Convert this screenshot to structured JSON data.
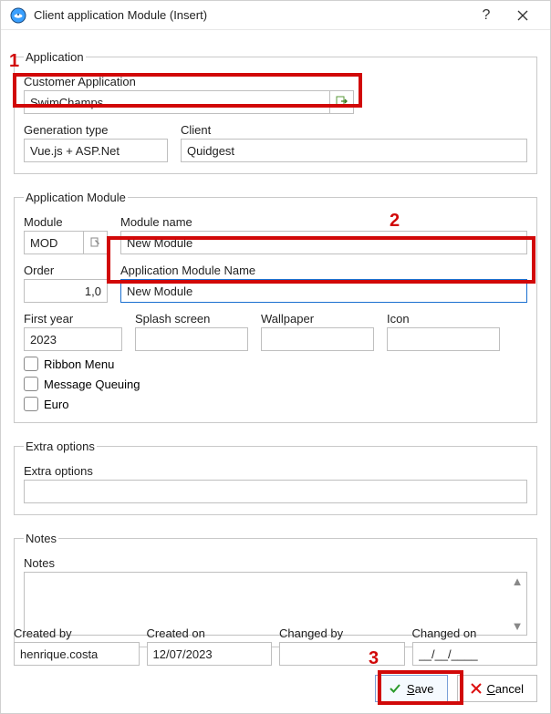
{
  "titlebar": {
    "title": "Client application Module (Insert)"
  },
  "annotations": {
    "a1": "1",
    "a2": "2",
    "a3": "3"
  },
  "application": {
    "legend": "Application",
    "customer_label": "Customer Application",
    "customer_value": "SwimChamps",
    "gen_label": "Generation type",
    "gen_value": "Vue.js + ASP.Net",
    "client_label": "Client",
    "client_value": "Quidgest"
  },
  "appmodule": {
    "legend": "Application Module",
    "module_label": "Module",
    "module_value": "MOD",
    "module_name_label": "Module name",
    "module_name_value": "New Module",
    "order_label": "Order",
    "order_value": "1,0",
    "app_module_name_label": "Application Module Name",
    "app_module_name_value": "New Module",
    "first_year_label": "First year",
    "first_year_value": "2023",
    "splash_label": "Splash screen",
    "wallpaper_label": "Wallpaper",
    "icon_label": "Icon",
    "ribbon_label": "Ribbon Menu",
    "mq_label": "Message Queuing",
    "euro_label": "Euro"
  },
  "extra": {
    "legend": "Extra options",
    "label": "Extra options"
  },
  "notes": {
    "legend": "Notes",
    "label": "Notes"
  },
  "footer": {
    "created_by_label": "Created by",
    "created_by_value": "henrique.costa",
    "created_on_label": "Created on",
    "created_on_value": "12/07/2023",
    "changed_by_label": "Changed by",
    "changed_by_value": "",
    "changed_on_label": "Changed on",
    "changed_on_value": "__/__/____",
    "save_label": "Save",
    "save_u": "S",
    "cancel_label": "Cancel",
    "cancel_u": "C"
  }
}
